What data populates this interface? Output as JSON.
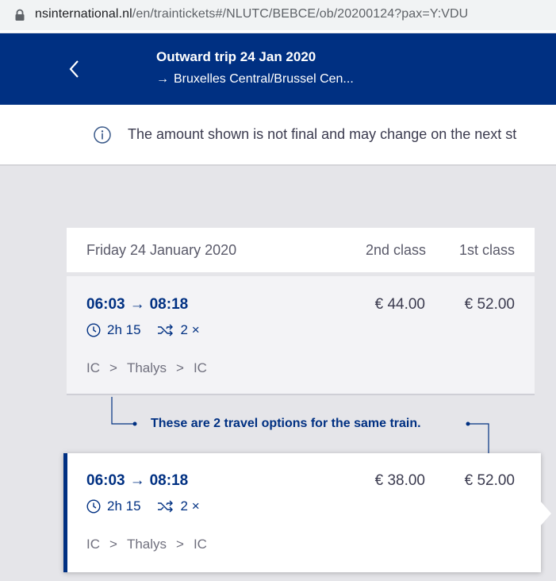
{
  "browser": {
    "url_domain": "nsinternational.nl",
    "url_path": "/en/traintickets#/NLUTC/BEBCE/ob/20200124?pax=Y:VDU"
  },
  "header": {
    "title": "Outward trip 24 Jan 2020",
    "destination_arrow": "→",
    "destination": "Bruxelles Central/Brussel Cen..."
  },
  "notice": {
    "text": "The amount shown is not final and may change on the next st"
  },
  "results": {
    "date": "Friday 24 January 2020",
    "col_2nd": "2nd class",
    "col_1st": "1st class",
    "trips": [
      {
        "depart": "06:03",
        "arrive": "08:18",
        "arrow": "→",
        "duration": "2h 15",
        "transfers": "2 ×",
        "route": [
          "IC",
          "Thalys",
          "IC"
        ],
        "price_2nd": "€ 44.00",
        "price_1st": "€ 52.00"
      },
      {
        "depart": "06:03",
        "arrive": "08:18",
        "arrow": "→",
        "duration": "2h 15",
        "transfers": "2 ×",
        "route": [
          "IC",
          "Thalys",
          "IC"
        ],
        "price_2nd": "€ 38.00",
        "price_1st": "€ 52.00"
      }
    ],
    "chevron": ">",
    "same_train_note": "These are 2 travel options for the same train."
  },
  "colors": {
    "brand": "#003082",
    "background": "#e5e5e9"
  }
}
